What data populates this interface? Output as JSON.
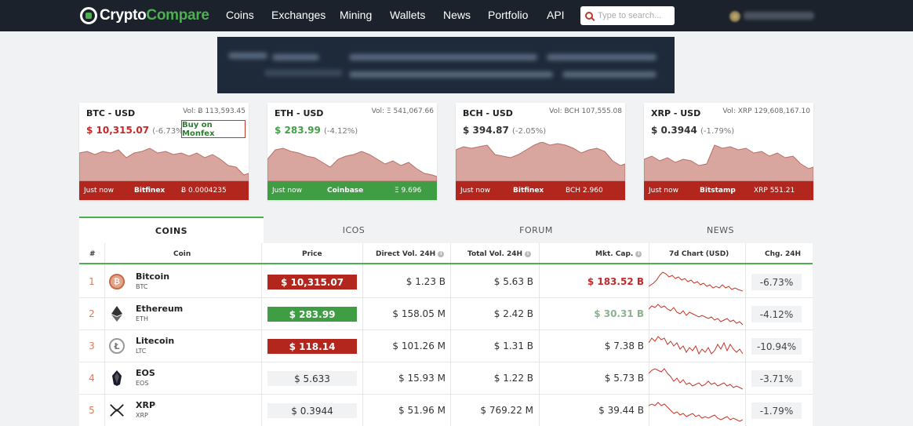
{
  "brand": {
    "name_part1": "Crypto",
    "name_part2": "Compare"
  },
  "nav": [
    "Coins",
    "Exchanges",
    "Mining",
    "Wallets",
    "News",
    "Portfolio",
    "API"
  ],
  "search": {
    "placeholder": "Type to search..."
  },
  "colors": {
    "nav_bg": "#1c222b",
    "accent_green": "#4caf50",
    "down_red": "#b3261e",
    "up_green": "#3f9e44",
    "chart_fill": "#d9a69f"
  },
  "cards": [
    {
      "pair": "BTC - USD",
      "vol": "Vol: Ƀ 113,593.45",
      "price": "$ 10,315.07",
      "change": "(-6.73%)",
      "direction": "down",
      "buy_label": "Buy on Monfex",
      "foot_time": "Just now",
      "foot_exchange": "Bitfinex",
      "foot_value": "Ƀ 0.0004235",
      "foot_color": "red"
    },
    {
      "pair": "ETH - USD",
      "vol": "Vol: Ξ 541,067.66",
      "price": "$ 283.99",
      "change": "(-4.12%)",
      "direction": "up",
      "foot_time": "Just now",
      "foot_exchange": "Coinbase",
      "foot_value": "Ξ 9.696",
      "foot_color": "green"
    },
    {
      "pair": "BCH - USD",
      "vol": "Vol: BCH 107,555.08",
      "price": "$ 394.87",
      "change": "(-2.05%)",
      "direction": "none",
      "foot_time": "Just now",
      "foot_exchange": "Bitfinex",
      "foot_value": "BCH 2.960",
      "foot_color": "red"
    },
    {
      "pair": "XRP - USD",
      "vol": "Vol: XRP 129,608,167.10",
      "price": "$ 0.3944",
      "change": "(-1.79%)",
      "direction": "none",
      "foot_time": "Just now",
      "foot_exchange": "Bitstamp",
      "foot_value": "XRP 551.21",
      "foot_color": "red"
    }
  ],
  "tabs": [
    "COINS",
    "ICOS",
    "FORUM",
    "NEWS"
  ],
  "table": {
    "headers": {
      "rank": "#",
      "coin": "Coin",
      "price": "Price",
      "direct_vol": "Direct Vol. 24H",
      "total_vol": "Total Vol. 24H",
      "mkt_cap": "Mkt. Cap.",
      "chart": "7d Chart (USD)",
      "change": "Chg. 24H"
    },
    "rows": [
      {
        "rank": "1",
        "name": "Bitcoin",
        "symbol": "BTC",
        "icon": "bitcoin-icon",
        "price": "$ 10,315.07",
        "price_style": "red",
        "direct_vol": "$ 1.23 B",
        "total_vol": "$ 5.63 B",
        "mkt_cap": "$ 183.52 B",
        "mkt_cap_style": "down",
        "change": "-6.73%"
      },
      {
        "rank": "2",
        "name": "Ethereum",
        "symbol": "ETH",
        "icon": "ethereum-icon",
        "price": "$ 283.99",
        "price_style": "green",
        "direct_vol": "$ 158.05 M",
        "total_vol": "$ 2.42 B",
        "mkt_cap": "$ 30.31 B",
        "mkt_cap_style": "up",
        "change": "-4.12%"
      },
      {
        "rank": "3",
        "name": "Litecoin",
        "symbol": "LTC",
        "icon": "litecoin-icon",
        "price": "$ 118.14",
        "price_style": "red",
        "direct_vol": "$ 101.26 M",
        "total_vol": "$ 1.31 B",
        "mkt_cap": "$ 7.38 B",
        "mkt_cap_style": "none",
        "change": "-10.94%"
      },
      {
        "rank": "4",
        "name": "EOS",
        "symbol": "EOS",
        "icon": "eos-icon",
        "price": "$ 5.633",
        "price_style": "plain",
        "direct_vol": "$ 15.93 M",
        "total_vol": "$ 1.22 B",
        "mkt_cap": "$ 5.73 B",
        "mkt_cap_style": "none",
        "change": "-3.71%"
      },
      {
        "rank": "5",
        "name": "XRP",
        "symbol": "XRP",
        "icon": "xrp-icon",
        "price": "$ 0.3944",
        "price_style": "plain",
        "direct_vol": "$ 51.96 M",
        "total_vol": "$ 769.22 M",
        "mkt_cap": "$ 39.44 B",
        "mkt_cap_style": "none",
        "change": "-1.79%"
      }
    ]
  }
}
